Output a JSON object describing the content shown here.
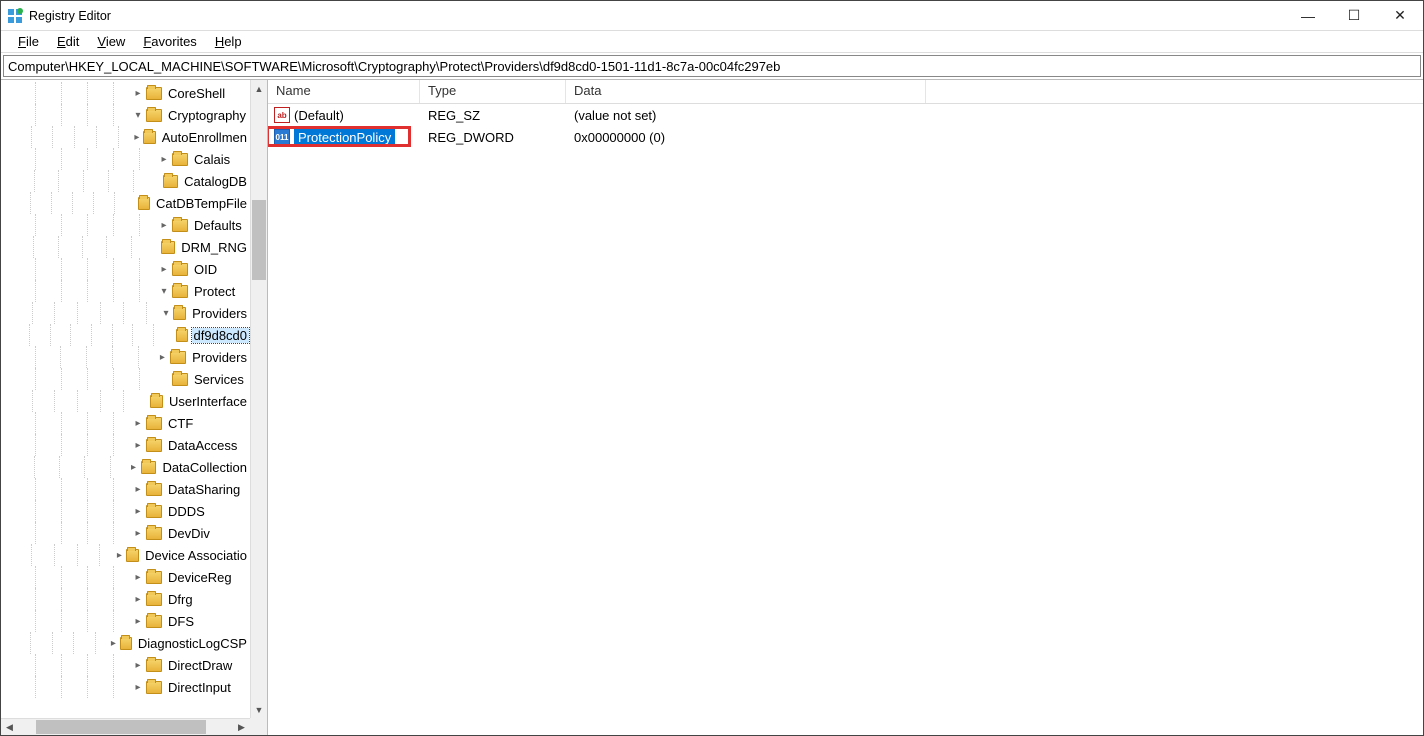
{
  "window": {
    "title": "Registry Editor"
  },
  "window_controls": {
    "minimize": "—",
    "maximize": "☐",
    "close": "✕"
  },
  "menu": {
    "file": "File",
    "edit": "Edit",
    "view": "View",
    "favorites": "Favorites",
    "help": "Help"
  },
  "address": "Computer\\HKEY_LOCAL_MACHINE\\SOFTWARE\\Microsoft\\Cryptography\\Protect\\Providers\\df9d8cd0-1501-11d1-8c7a-00c04fc297eb",
  "tree": {
    "items": [
      {
        "label": "CoreShell",
        "depth": 5,
        "twisty": "right"
      },
      {
        "label": "Cryptography",
        "depth": 5,
        "twisty": "down"
      },
      {
        "label": "AutoEnrollmen",
        "depth": 6,
        "twisty": "right"
      },
      {
        "label": "Calais",
        "depth": 6,
        "twisty": "right"
      },
      {
        "label": "CatalogDB",
        "depth": 6,
        "twisty": "none"
      },
      {
        "label": "CatDBTempFile",
        "depth": 6,
        "twisty": "none"
      },
      {
        "label": "Defaults",
        "depth": 6,
        "twisty": "right"
      },
      {
        "label": "DRM_RNG",
        "depth": 6,
        "twisty": "none"
      },
      {
        "label": "OID",
        "depth": 6,
        "twisty": "right"
      },
      {
        "label": "Protect",
        "depth": 6,
        "twisty": "down"
      },
      {
        "label": "Providers",
        "depth": 7,
        "twisty": "down"
      },
      {
        "label": "df9d8cd0",
        "depth": 8,
        "twisty": "none",
        "selected": true
      },
      {
        "label": "Providers",
        "depth": 6,
        "twisty": "right"
      },
      {
        "label": "Services",
        "depth": 6,
        "twisty": "none"
      },
      {
        "label": "UserInterface",
        "depth": 6,
        "twisty": "none"
      },
      {
        "label": "CTF",
        "depth": 5,
        "twisty": "right"
      },
      {
        "label": "DataAccess",
        "depth": 5,
        "twisty": "right"
      },
      {
        "label": "DataCollection",
        "depth": 5,
        "twisty": "right"
      },
      {
        "label": "DataSharing",
        "depth": 5,
        "twisty": "right"
      },
      {
        "label": "DDDS",
        "depth": 5,
        "twisty": "right"
      },
      {
        "label": "DevDiv",
        "depth": 5,
        "twisty": "right"
      },
      {
        "label": "Device Associatio",
        "depth": 5,
        "twisty": "right"
      },
      {
        "label": "DeviceReg",
        "depth": 5,
        "twisty": "right"
      },
      {
        "label": "Dfrg",
        "depth": 5,
        "twisty": "right"
      },
      {
        "label": "DFS",
        "depth": 5,
        "twisty": "right"
      },
      {
        "label": "DiagnosticLogCSP",
        "depth": 5,
        "twisty": "right"
      },
      {
        "label": "DirectDraw",
        "depth": 5,
        "twisty": "right"
      },
      {
        "label": "DirectInput",
        "depth": 5,
        "twisty": "right"
      }
    ]
  },
  "list": {
    "columns": {
      "name": "Name",
      "type": "Type",
      "data": "Data"
    },
    "rows": [
      {
        "icon": "sz",
        "icon_text": "ab",
        "name": "(Default)",
        "type": "REG_SZ",
        "data": "(value not set)",
        "selected": false,
        "highlighted": false
      },
      {
        "icon": "dw",
        "icon_text": "011",
        "name": "ProtectionPolicy",
        "type": "REG_DWORD",
        "data": "0x00000000 (0)",
        "selected": true,
        "highlighted": true
      }
    ]
  }
}
